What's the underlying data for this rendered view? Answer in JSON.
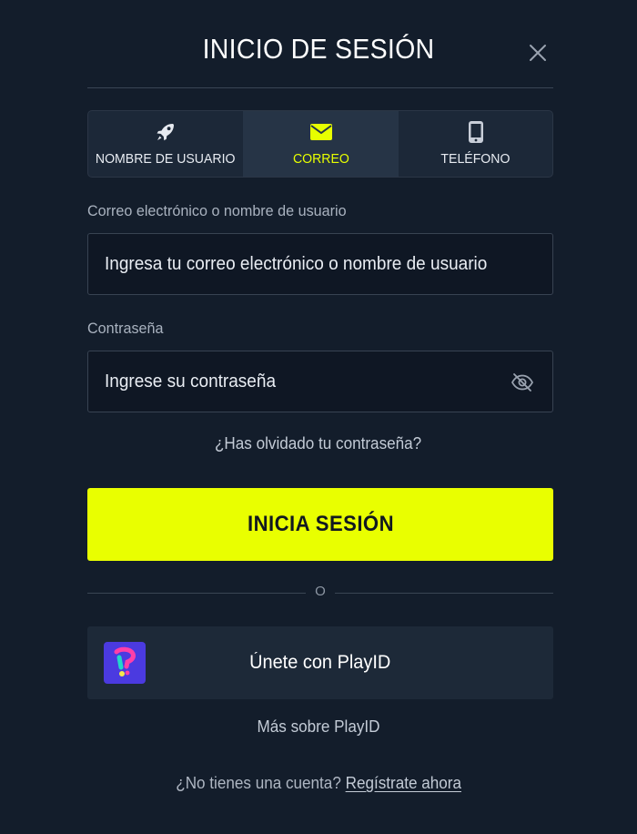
{
  "header": {
    "title": "INICIO DE SESIÓN",
    "close_icon": "close-icon"
  },
  "tabs": [
    {
      "label": "NOMBRE DE USUARIO",
      "icon": "rocket-icon",
      "active": false
    },
    {
      "label": "CORREO",
      "icon": "envelope-icon",
      "active": true
    },
    {
      "label": "TELÉFONO",
      "icon": "phone-icon",
      "active": false
    }
  ],
  "form": {
    "email": {
      "label": "Correo electrónico o nombre de usuario",
      "placeholder": "Ingresa tu correo electrónico o nombre de usuario",
      "value": ""
    },
    "password": {
      "label": "Contraseña",
      "placeholder": "Ingrese su contraseña",
      "value": "",
      "toggle_icon": "eye-slash-icon"
    },
    "forgot_link": "¿Has olvidado tu contraseña?",
    "submit_label": "INICIA SESIÓN"
  },
  "divider_text": "O",
  "playid": {
    "button_label": "Únete con PlayID",
    "logo_icon": "playid-logo-icon",
    "info_link": "Más sobre PlayID"
  },
  "signup": {
    "prompt": "¿No tienes una cuenta?",
    "link": "Regístrate ahora"
  },
  "colors": {
    "background": "#131d2b",
    "accent": "#e9ff00",
    "panel": "#1d2938",
    "input_bg": "#0f1724"
  }
}
